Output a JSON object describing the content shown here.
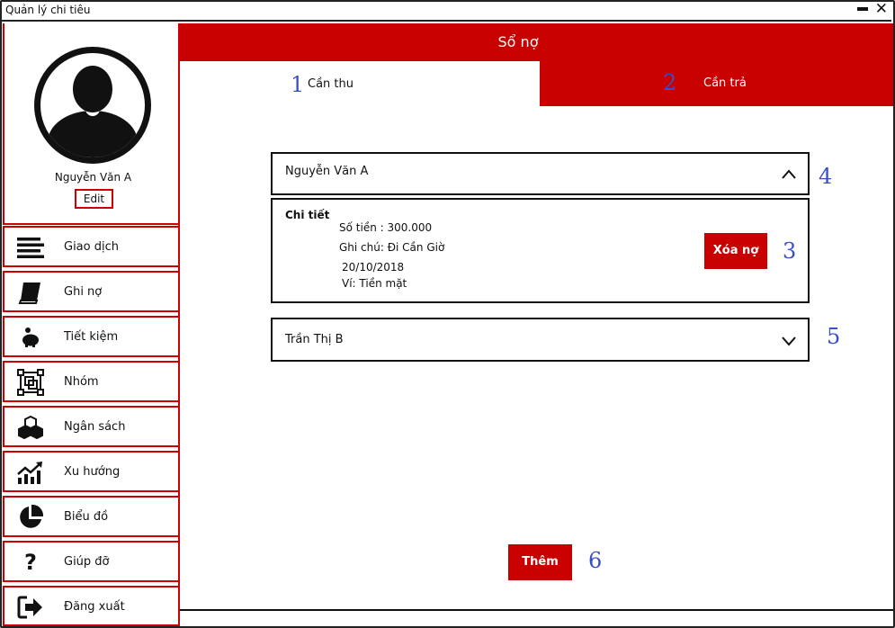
{
  "window": {
    "title": "Quản lý chi tiêu"
  },
  "profile": {
    "name": "Nguyễn Văn A",
    "edit_label": "Edit"
  },
  "sidebar": {
    "items": [
      {
        "label": "Giao dịch",
        "icon": "list-icon"
      },
      {
        "label": "Ghi nợ",
        "icon": "book-icon"
      },
      {
        "label": "Tiết kiệm",
        "icon": "piggy-bank-icon"
      },
      {
        "label": "Nhóm",
        "icon": "group-icon"
      },
      {
        "label": "Ngân sách",
        "icon": "boxes-icon"
      },
      {
        "label": "Xu hướng",
        "icon": "trend-icon"
      },
      {
        "label": "Biểu đồ",
        "icon": "pie-chart-icon"
      },
      {
        "label": "Giúp đỡ",
        "icon": "question-icon"
      },
      {
        "label": "Đăng xuất",
        "icon": "logout-icon"
      }
    ]
  },
  "header": {
    "title": "Sổ nợ"
  },
  "tabs": [
    {
      "number": "1",
      "label": "Cần thu"
    },
    {
      "number": "2",
      "label": "Cần trả"
    }
  ],
  "debts": [
    {
      "name": "Nguyễn Văn A",
      "detail_title": "Chi tiết",
      "amount": "Số tiền : 300.000",
      "note": "Ghi chú: Đi Cần Giờ",
      "date": "20/10/2018",
      "wallet": "Ví: Tiền mặt",
      "delete_label": "Xóa nợ"
    },
    {
      "name": "Trần Thị B"
    }
  ],
  "annotations": {
    "delete": "3",
    "item1": "4",
    "item2": "5",
    "add": "6"
  },
  "add_label": "Thêm",
  "colors": {
    "accent": "#c80000",
    "annotation": "#3a4fc4"
  }
}
